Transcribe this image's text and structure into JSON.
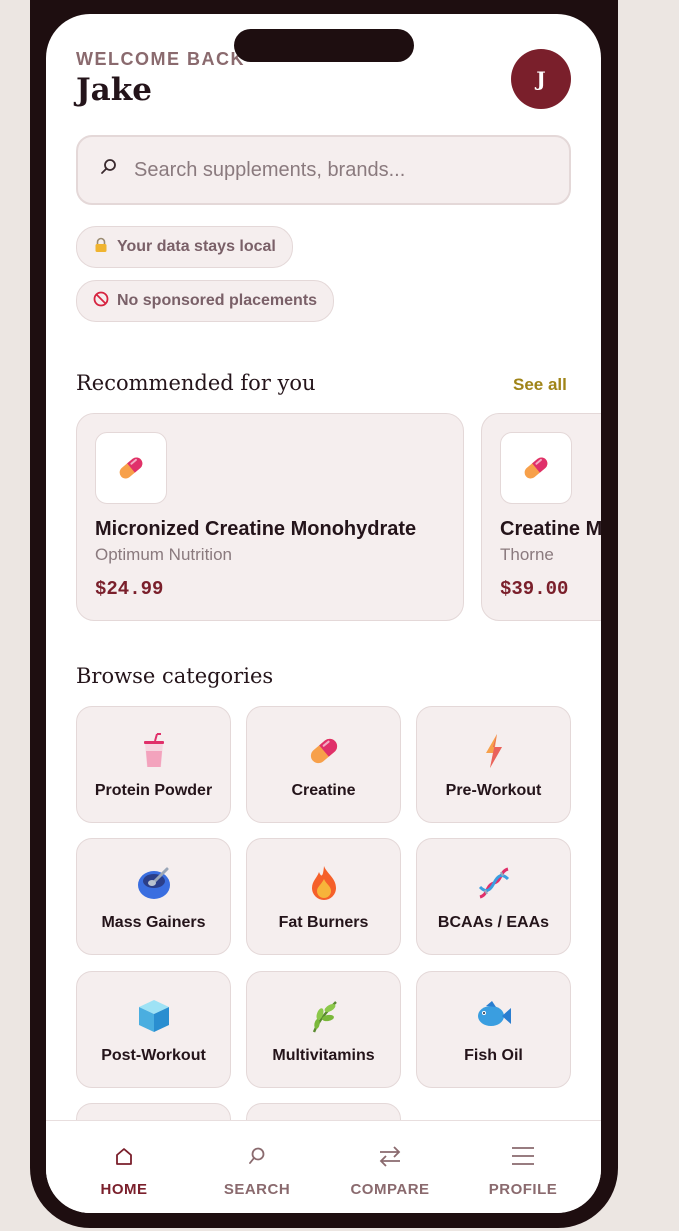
{
  "header": {
    "welcome": "WELCOME BACK",
    "user_name": "Jake",
    "avatar_initial": "J"
  },
  "search": {
    "placeholder": "Search supplements, brands..."
  },
  "badges": [
    {
      "icon": "lock-icon",
      "label": "Your data stays local"
    },
    {
      "icon": "no-sign-icon",
      "label": "No sponsored placements"
    }
  ],
  "recommended": {
    "title": "Recommended for you",
    "see_all": "See all",
    "items": [
      {
        "name": "Micronized Creatine Monohydrate",
        "brand": "Optimum Nutrition",
        "price": "$24.99",
        "icon": "pill-icon"
      },
      {
        "name": "Creatine M",
        "brand": "Thorne",
        "price": "$39.00",
        "icon": "pill-icon"
      }
    ]
  },
  "categories": {
    "title": "Browse categories",
    "items": [
      {
        "label": "Protein Powder",
        "icon": "cup-icon"
      },
      {
        "label": "Creatine",
        "icon": "pill-icon"
      },
      {
        "label": "Pre-Workout",
        "icon": "lightning-icon"
      },
      {
        "label": "Mass Gainers",
        "icon": "bowl-icon"
      },
      {
        "label": "Fat Burners",
        "icon": "fire-icon"
      },
      {
        "label": "BCAAs / EAAs",
        "icon": "dna-icon"
      },
      {
        "label": "Post-Workout",
        "icon": "ice-cube-icon"
      },
      {
        "label": "Multivitamins",
        "icon": "herb-icon"
      },
      {
        "label": "Fish Oil",
        "icon": "fish-icon"
      }
    ]
  },
  "tabs": [
    {
      "label": "HOME",
      "icon": "home-icon",
      "active": true
    },
    {
      "label": "SEARCH",
      "icon": "search-icon",
      "active": false
    },
    {
      "label": "COMPARE",
      "icon": "compare-icon",
      "active": false
    },
    {
      "label": "PROFILE",
      "icon": "menu-icon",
      "active": false
    }
  ],
  "colors": {
    "accent": "#7a1f2b",
    "link": "#a08418",
    "card_bg": "#f5eeee"
  }
}
